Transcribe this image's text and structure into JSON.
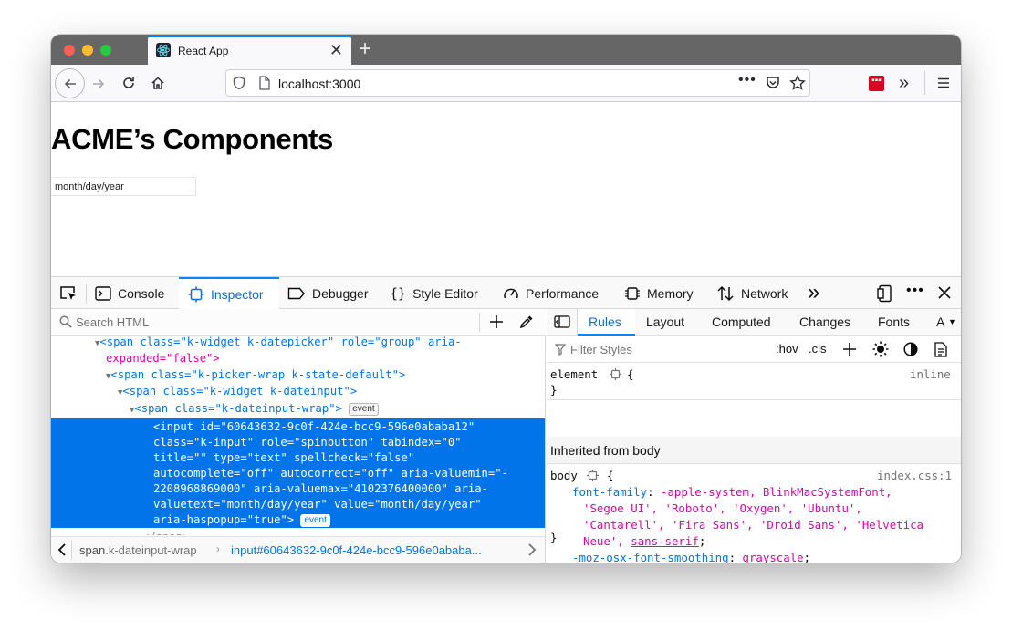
{
  "browser": {
    "tab_title": "React App",
    "url": "localhost:3000"
  },
  "page": {
    "heading": "ACME’s Components",
    "date_input_value": "month/day/year"
  },
  "devtools": {
    "tabs": [
      "Console",
      "Inspector",
      "Debugger",
      "Style Editor",
      "Performance",
      "Memory",
      "Network"
    ],
    "search_placeholder": "Search HTML",
    "markup": {
      "line1a": "<span class=\"k-widget k-datepicker\" role=\"group\" aria-",
      "line1b": "expanded=\"false\">",
      "line2": "<span class=\"k-picker-wrap k-state-default\">",
      "line3": "<span class=\"k-widget k-dateinput\">",
      "line4": "<span class=\"k-dateinput-wrap\">",
      "sel1": "<input id=\"60643632-9c0f-424e-bcc9-596e0ababa12\"",
      "sel2": "class=\"k-input\" role=\"spinbutton\" tabindex=\"0\"",
      "sel3": "title=\"\" type=\"text\" spellcheck=\"false\"",
      "sel4": "autocomplete=\"off\" autocorrect=\"off\" aria-valuemin=\"-",
      "sel5": "2208968869000\" aria-valuemax=\"4102376400000\" aria-",
      "sel6": "valuetext=\"month/day/year\" value=\"month/day/year\"",
      "sel7": "aria-haspopup=\"true\">",
      "partial": "</span>",
      "event_badge": "event"
    },
    "breadcrumbs": {
      "item1_tag": "span",
      "item1_class": ".k-dateinput-wrap",
      "item2_tag": "input",
      "item2_id": "#60643632-9c0f-424e-bcc9-596e0ababa..."
    },
    "rules_tabs": [
      "Rules",
      "Layout",
      "Computed",
      "Changes",
      "Fonts",
      "A"
    ],
    "filter_placeholder": "Filter Styles",
    "hov": ":hov",
    "cls": ".cls",
    "element_rule": {
      "selector": "element",
      "open": "{",
      "close": "}",
      "source": "inline"
    },
    "inherited_label": "Inherited from body",
    "body_rule": {
      "selector": "body",
      "open": "{",
      "source": "index.css:1",
      "prop1": "font-family",
      "val1a": "-apple-system, BlinkMacSystemFont,",
      "val1b": "'Segoe UI', 'Roboto', 'Oxygen', 'Ubuntu',",
      "val1c": "'Cantarell', 'Fira Sans', 'Droid Sans', 'Helvetica",
      "val1d": "Neue', ",
      "val1e": "sans-serif",
      "prop2": "-moz-osx-font-smoothing",
      "val2": "grayscale",
      "close": "}"
    }
  },
  "colors": {
    "accent": "#0a84ff",
    "selection": "#0074e8",
    "tag": "#0074e8",
    "attribute": "#dd00a9",
    "value": "#003eaa"
  }
}
